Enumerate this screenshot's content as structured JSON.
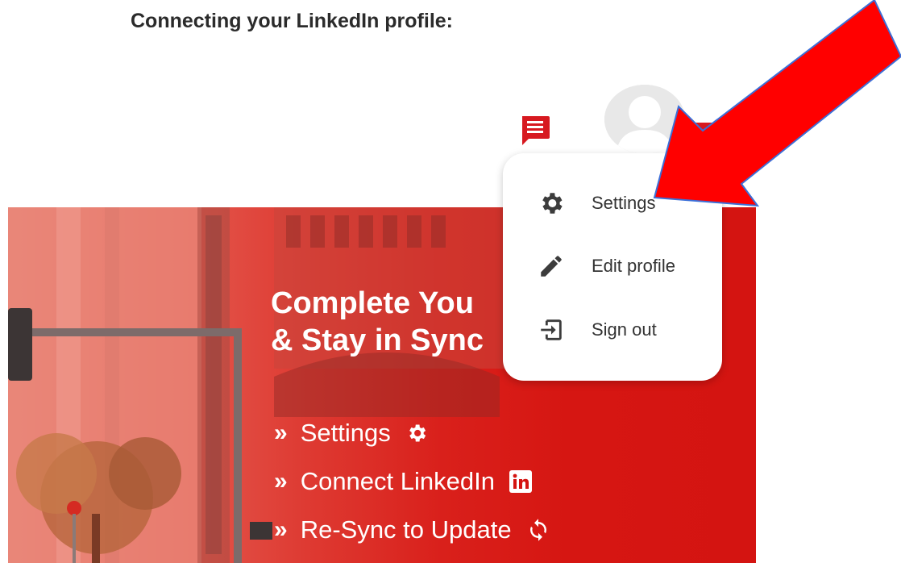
{
  "heading": "Connecting your LinkedIn profile:",
  "header": {
    "chat_icon": "chat-bubble-icon",
    "avatar_icon": "user-avatar-icon",
    "dropdown_icon": "caret-down-icon"
  },
  "menu": {
    "items": [
      {
        "label": "Settings",
        "icon": "gear-icon"
      },
      {
        "label": "Edit profile",
        "icon": "pencil-icon"
      },
      {
        "label": "Sign out",
        "icon": "sign-out-icon"
      }
    ]
  },
  "banner": {
    "title_line1": "Complete You",
    "title_line2": "& Stay in Sync",
    "steps": [
      {
        "chevron": "»",
        "label": "Settings",
        "icon": "gear-icon"
      },
      {
        "chevron": "»",
        "label": "Connect LinkedIn",
        "icon": "linkedin-icon"
      },
      {
        "chevron": "»",
        "label": "Re-Sync to Update",
        "icon": "sync-icon"
      }
    ]
  },
  "colors": {
    "brand_red": "#d71920",
    "arrow_red": "#ff0000",
    "arrow_outline": "#3b6fd8",
    "text_dark": "#2b2b2b"
  }
}
